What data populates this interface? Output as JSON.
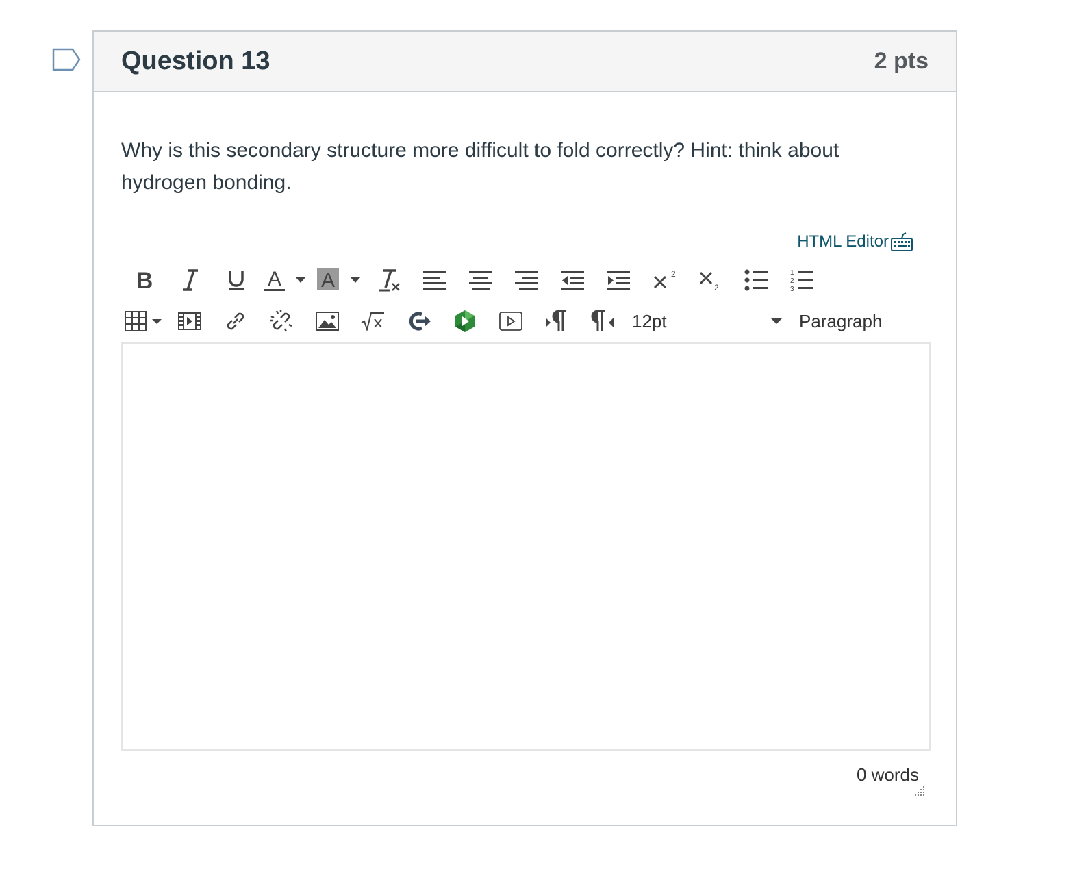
{
  "question": {
    "title": "Question 13",
    "points": "2 pts",
    "text": "Why is this secondary structure more difficult to fold correctly? Hint: think about hydrogen bonding."
  },
  "editor": {
    "html_editor_label": "HTML Editor",
    "font_size": "12pt",
    "block_format": "Paragraph",
    "word_count": "0 words",
    "content": ""
  },
  "toolbar": {
    "row1": [
      "bold",
      "italic",
      "underline",
      "text-color",
      "background-color",
      "clear-formatting",
      "align-left",
      "align-center",
      "align-right",
      "outdent",
      "indent",
      "superscript",
      "subscript",
      "bullet-list",
      "numbered-list"
    ],
    "row2": [
      "table",
      "media",
      "link",
      "unlink",
      "image",
      "equation",
      "embed",
      "app",
      "video",
      "ltr",
      "rtl"
    ]
  },
  "colors": {
    "accent": "#0e566c",
    "border": "#c7cdd1",
    "header_bg": "#f5f5f5",
    "text": "#2d3b45"
  }
}
